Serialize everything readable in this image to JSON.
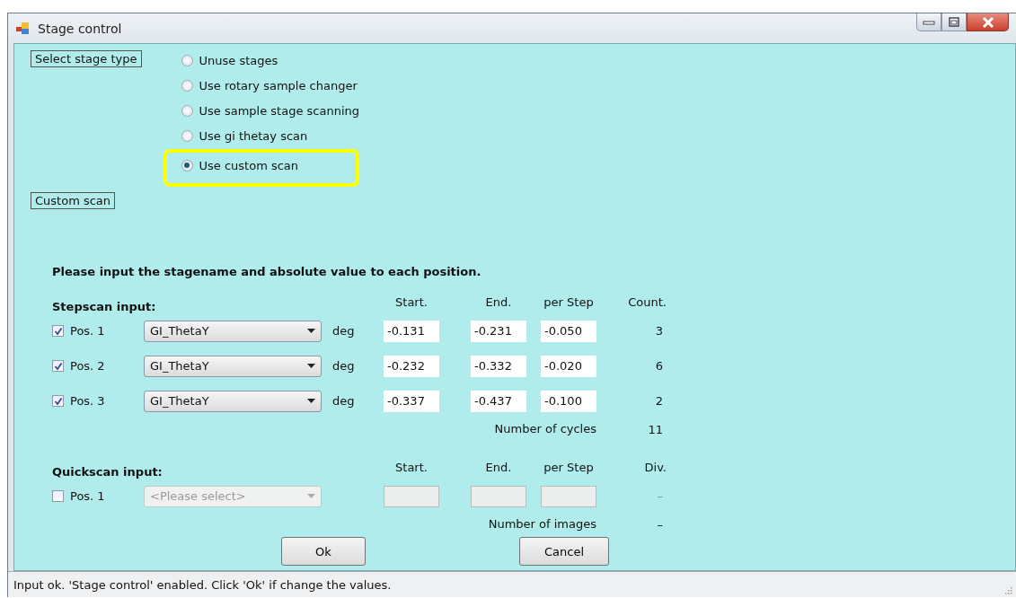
{
  "window": {
    "title": "Stage control"
  },
  "stage_type": {
    "label": "Select stage type",
    "options": [
      {
        "label": "Unuse stages",
        "selected": false,
        "highlighted": false
      },
      {
        "label": "Use rotary sample changer",
        "selected": false,
        "highlighted": false
      },
      {
        "label": "Use sample stage scanning",
        "selected": false,
        "highlighted": false
      },
      {
        "label": "Use gi thetay scan",
        "selected": false,
        "highlighted": false
      },
      {
        "label": "Use custom scan",
        "selected": true,
        "highlighted": true
      }
    ]
  },
  "custom_scan": {
    "label": "Custom scan",
    "instruction": "Please input the stagename and absolute value to each position.",
    "stepscan": {
      "title": "Stepscan input:",
      "headers": [
        "Start.",
        "End.",
        "per Step",
        "Count."
      ],
      "rows": [
        {
          "label": "Pos. 1",
          "checked": true,
          "disabled": false,
          "stage": "GI_ThetaY",
          "unit": "deg",
          "start": "-0.131",
          "end": "-0.231",
          "step": "-0.050",
          "count": "3"
        },
        {
          "label": "Pos. 2",
          "checked": true,
          "disabled": false,
          "stage": "GI_ThetaY",
          "unit": "deg",
          "start": "-0.232",
          "end": "-0.332",
          "step": "-0.020",
          "count": "6"
        },
        {
          "label": "Pos. 3",
          "checked": true,
          "disabled": false,
          "stage": "GI_ThetaY",
          "unit": "deg",
          "start": "-0.337",
          "end": "-0.437",
          "step": "-0.100",
          "count": "2"
        }
      ],
      "total_label": "Number of cycles",
      "total": "11"
    },
    "quickscan": {
      "title": "Quickscan input:",
      "headers": [
        "Start.",
        "End.",
        "per Step",
        "Div."
      ],
      "rows": [
        {
          "label": "Pos. 1",
          "checked": false,
          "disabled": true,
          "placeholder": "<Please select>",
          "count": "–"
        }
      ],
      "total_label": "Number of images",
      "total": "–"
    }
  },
  "buttons": [
    {
      "label": "Ok",
      "kind": "ok"
    },
    {
      "label": "Cancel",
      "kind": "cancel"
    }
  ],
  "status_bar": {
    "text": "Input ok. 'Stage control' enabled. Click 'Ok' if change the values."
  }
}
